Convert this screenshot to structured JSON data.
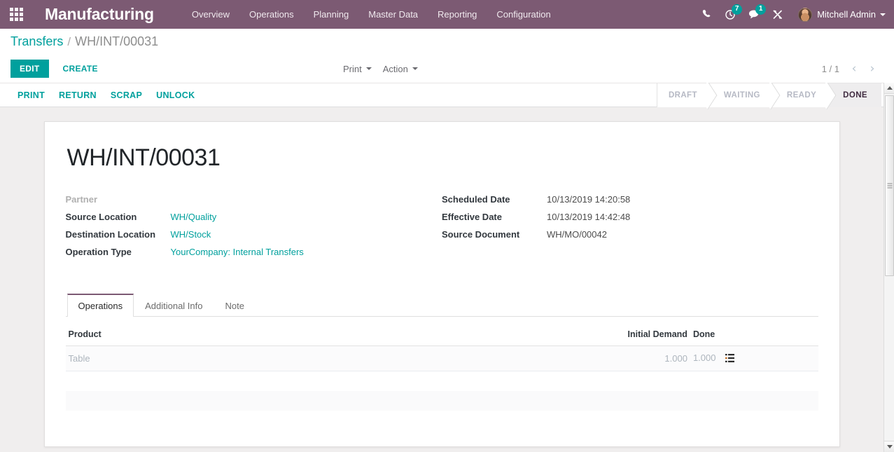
{
  "navbar": {
    "apps_icon": "apps-grid-icon",
    "brand": "Manufacturing",
    "menu": [
      {
        "label": "Overview"
      },
      {
        "label": "Operations"
      },
      {
        "label": "Planning"
      },
      {
        "label": "Master Data"
      },
      {
        "label": "Reporting"
      },
      {
        "label": "Configuration"
      }
    ],
    "icons": [
      {
        "name": "phone-icon",
        "badge": ""
      },
      {
        "name": "activity-clock-icon",
        "badge": "7"
      },
      {
        "name": "messages-chat-icon",
        "badge": "1"
      },
      {
        "name": "debug-tools-icon",
        "badge": ""
      }
    ],
    "user": "Mitchell Admin",
    "accent_color": "#7C5A73",
    "badge_color": "#00A09D"
  },
  "breadcrumb": {
    "root": "Transfers",
    "separator": "/",
    "current": "WH/INT/00031"
  },
  "control_panel": {
    "edit_label": "EDIT",
    "create_label": "CREATE",
    "print_label": "Print",
    "action_label": "Action",
    "pager_count": "1 / 1",
    "prev_icon": "chevron-left-icon",
    "next_icon": "chevron-right-icon"
  },
  "statusbar_buttons": [
    {
      "label": "PRINT"
    },
    {
      "label": "RETURN"
    },
    {
      "label": "SCRAP"
    },
    {
      "label": "UNLOCK"
    }
  ],
  "status_stages": [
    {
      "label": "DRAFT",
      "active": false
    },
    {
      "label": "WAITING",
      "active": false
    },
    {
      "label": "READY",
      "active": false
    },
    {
      "label": "DONE",
      "active": true
    }
  ],
  "record": {
    "title": "WH/INT/00031",
    "left_fields": [
      {
        "label": "Partner",
        "value": "",
        "link": false,
        "empty_label": true
      },
      {
        "label": "Source Location",
        "value": "WH/Quality",
        "link": true
      },
      {
        "label": "Destination Location",
        "value": "WH/Stock",
        "link": true
      },
      {
        "label": "Operation Type",
        "value": "YourCompany: Internal Transfers",
        "link": true
      }
    ],
    "right_fields": [
      {
        "label": "Scheduled Date",
        "value": "10/13/2019 14:20:58",
        "link": false
      },
      {
        "label": "Effective Date",
        "value": "10/13/2019 14:42:48",
        "link": false
      },
      {
        "label": "Source Document",
        "value": "WH/MO/00042",
        "link": false
      }
    ]
  },
  "tabs": [
    {
      "label": "Operations",
      "active": true
    },
    {
      "label": "Additional Info",
      "active": false
    },
    {
      "label": "Note",
      "active": false
    }
  ],
  "operations_table": {
    "columns": [
      "Product",
      "Initial Demand",
      "Done"
    ],
    "rows": [
      {
        "product": "Table",
        "initial_demand": "1.000",
        "done": "1.000",
        "detail_icon": "list-detail-icon"
      }
    ]
  },
  "scrollbar": {
    "up_icon": "scroll-up-arrow-icon",
    "down_icon": "scroll-down-arrow-icon"
  }
}
